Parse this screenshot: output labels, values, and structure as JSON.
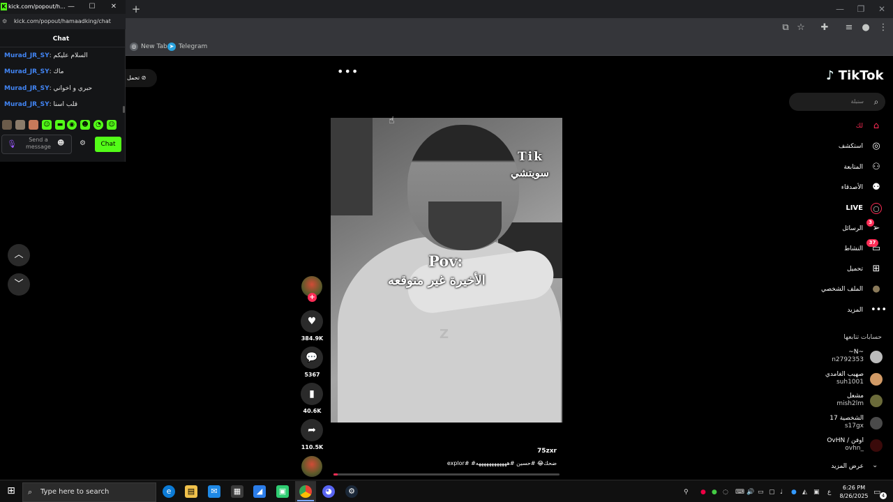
{
  "browser": {
    "new_tab_symbol": "+",
    "bookmarks": [
      {
        "label": "New Tab",
        "icon": "globe-icon"
      },
      {
        "label": "Telegram",
        "icon": "telegram-icon"
      }
    ],
    "window_controls": [
      "minimize",
      "maximize",
      "close"
    ]
  },
  "kick_popout": {
    "title": "kick.com/popout/h...",
    "url": "kick.com/popout/hamaadking/chat",
    "header": "Chat",
    "messages": [
      {
        "user": "Murad_JR_SY",
        "text": "السلام عليكم"
      },
      {
        "user": "Murad_JR_SY",
        "text": "ماك"
      },
      {
        "user": "Murad_JR_SY",
        "text": "حبري و اخواني"
      },
      {
        "user": "Murad_JR_SY",
        "text": "قلب اسنا"
      }
    ],
    "input_placeholder": "Send a message",
    "chat_button": "Chat",
    "brand_color": "#53fc18"
  },
  "tiktok": {
    "logo": "TikTok",
    "search_placeholder": "سنبلة",
    "left_pill": "تحمل",
    "nav": [
      {
        "label": "لك",
        "icon": "home-icon",
        "active": true
      },
      {
        "label": "استكشف",
        "icon": "compass-icon"
      },
      {
        "label": "المتابعة",
        "icon": "follow-icon"
      },
      {
        "label": "الأصدقاء",
        "icon": "friends-icon"
      },
      {
        "label": "LIVE",
        "icon": "live-icon"
      },
      {
        "label": "الرسائل",
        "icon": "messages-icon",
        "badge": "3"
      },
      {
        "label": "النشاط",
        "icon": "activity-icon",
        "badge": "37"
      },
      {
        "label": "تحميل",
        "icon": "upload-icon"
      },
      {
        "label": "الملف الشخصي",
        "icon": "profile-avatar-icon"
      },
      {
        "label": "المزيد",
        "icon": "more-icon"
      }
    ],
    "following_header": "حسابات تتابعها",
    "following": [
      {
        "name": "~N~",
        "handle": "n2792353"
      },
      {
        "name": "صهيب الغامدي",
        "handle": "suh1001"
      },
      {
        "name": "مشعل",
        "handle": "mish2lm"
      },
      {
        "name": "الشخصية 17",
        "handle": "s17gx"
      },
      {
        "name": "OvHN / اوفن",
        "handle": "ovhn_"
      }
    ],
    "see_more": "عرض المزيد",
    "video": {
      "overlay_tik": "Tik",
      "overlay_switch": "سويتشي",
      "overlay_pov": "Pov:",
      "overlay_caption": "الأخيرة غير متوقعه",
      "overlay_z": "Z",
      "username": "75zxr",
      "caption": "explor# #ضحك😂 #حسين #ههههههههههههه",
      "progress": 0.02
    },
    "actions": {
      "likes": "384.9K",
      "comments": "5367",
      "saves": "40.6K",
      "shares": "110.5K"
    },
    "accent": "#fe2c55"
  },
  "taskbar": {
    "search_placeholder": "Type here to search",
    "time": "6:26 PM",
    "date": "8/26/2025",
    "notifications": "4",
    "lang": "ع"
  }
}
